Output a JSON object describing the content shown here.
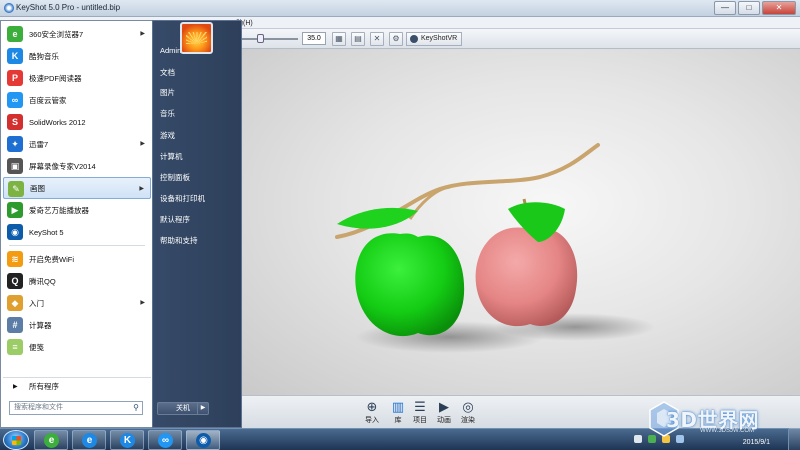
{
  "app": {
    "title": "KeyShot 5.0 Pro  - untitled.bip",
    "menu_help": "助(H)",
    "zoom_value": "35.0",
    "keyshotvr_label": "KeyShotVR",
    "window_buttons": {
      "minimize": "—",
      "maximize": "□",
      "close": "✕"
    }
  },
  "bottom_bar": {
    "buttons": [
      {
        "label": "导入",
        "icon": "import-icon"
      },
      {
        "label": "库",
        "icon": "library-icon"
      },
      {
        "label": "项目",
        "icon": "project-icon"
      },
      {
        "label": "动画",
        "icon": "animation-icon"
      },
      {
        "label": "渲染",
        "icon": "render-icon"
      }
    ]
  },
  "start_menu": {
    "programs": [
      {
        "label": "360安全浏览器7",
        "has_submenu": true,
        "color": "#3cae3c",
        "glyph": "e"
      },
      {
        "label": "酷狗音乐",
        "has_submenu": false,
        "color": "#1e88e5",
        "glyph": "K"
      },
      {
        "label": "极速PDF阅读器",
        "has_submenu": false,
        "color": "#e53935",
        "glyph": "P"
      },
      {
        "label": "百度云管家",
        "has_submenu": false,
        "color": "#2196f3",
        "glyph": "∞"
      },
      {
        "label": "SolidWorks 2012",
        "has_submenu": false,
        "color": "#d32f2f",
        "glyph": "S"
      },
      {
        "label": "迅雷7",
        "has_submenu": true,
        "color": "#1e6fd1",
        "glyph": "✦"
      },
      {
        "label": "屏幕录像专家V2014",
        "has_submenu": false,
        "color": "#555555",
        "glyph": "▣"
      },
      {
        "label": "画图",
        "has_submenu": true,
        "color": "#7cb342",
        "glyph": "✎"
      },
      {
        "label": "爱奇艺万能播放器",
        "has_submenu": false,
        "color": "#2e9b2e",
        "glyph": "▶"
      },
      {
        "label": "KeyShot 5",
        "has_submenu": false,
        "color": "#0d5cab",
        "glyph": "◉"
      }
    ],
    "programs_lower": [
      {
        "label": "开启免费WiFi",
        "has_submenu": false,
        "color": "#f39c12",
        "glyph": "≋"
      },
      {
        "label": "腾讯QQ",
        "has_submenu": false,
        "color": "#222222",
        "glyph": "Q"
      },
      {
        "label": "入门",
        "has_submenu": true,
        "color": "#e0a030",
        "glyph": "◆"
      },
      {
        "label": "计算器",
        "has_submenu": false,
        "color": "#5b7da6",
        "glyph": "#"
      },
      {
        "label": "便笺",
        "has_submenu": false,
        "color": "#9ccc65",
        "glyph": "≡"
      }
    ],
    "selected_index": 7,
    "all_programs": "所有程序",
    "search_placeholder": "搜索程序和文件",
    "places": [
      "Administrator",
      "文档",
      "图片",
      "音乐",
      "游戏",
      "计算机",
      "控制面板",
      "设备和打印机",
      "默认程序",
      "帮助和支持"
    ],
    "shutdown_label": "关机"
  },
  "taskbar": {
    "time": "",
    "date": "2015/9/1",
    "tasks": [
      {
        "name": "ie-360",
        "color": "#3cae3c",
        "glyph": "e"
      },
      {
        "name": "internet-explorer",
        "color": "#1e88e5",
        "glyph": "e"
      },
      {
        "name": "kugou",
        "color": "#1e88e5",
        "glyph": "K"
      },
      {
        "name": "baidu-cloud",
        "color": "#2196f3",
        "glyph": "∞"
      },
      {
        "name": "keyshot",
        "color": "#0d5cab",
        "glyph": "◉"
      }
    ]
  },
  "watermark": {
    "text": "3D世界网",
    "sub": "WWW.3DSJW.COM"
  },
  "colors": {
    "apple_green": "#1fd21f",
    "apple_red": "#e58a8a",
    "stem": "#c9a46c"
  }
}
